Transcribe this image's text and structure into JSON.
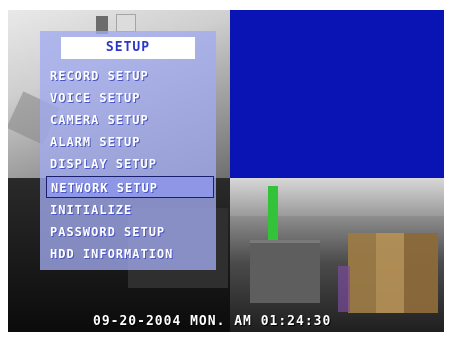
{
  "menu": {
    "title": "SETUP",
    "items": [
      {
        "label": "RECORD SETUP"
      },
      {
        "label": "VOICE SETUP"
      },
      {
        "label": "CAMERA SETUP"
      },
      {
        "label": "ALARM  SETUP"
      },
      {
        "label": "DISPLAY SETUP"
      },
      {
        "label": "NETWORK SETUP",
        "selected": true
      },
      {
        "label": "INITIALIZE"
      },
      {
        "label": "PASSWORD SETUP"
      },
      {
        "label": "HDD INFORMATION"
      }
    ]
  },
  "status": {
    "datetime": "09-20-2004 MON. AM 01:24:30"
  },
  "colors": {
    "no_signal_blue": "#0a14b4",
    "menu_title_text": "#2a35c9"
  }
}
